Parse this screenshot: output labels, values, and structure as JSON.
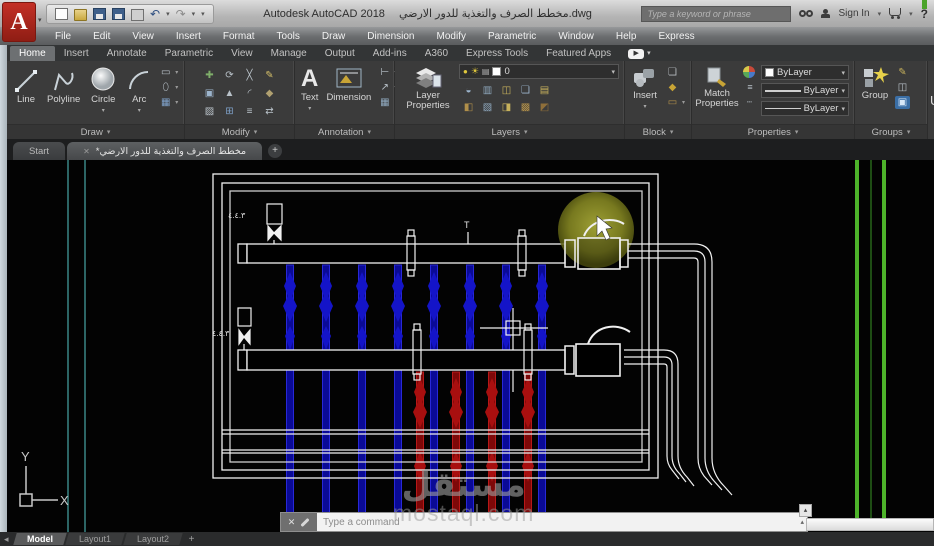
{
  "titlebar": {
    "app_title": "Autodesk AutoCAD 2018",
    "doc_title": "مخطط الصرف والتغذية للدور الارضي.dwg",
    "search_placeholder": "Type a keyword or phrase",
    "sign_in_label": "Sign In",
    "help_glyph": "?"
  },
  "menubar": {
    "items": [
      "File",
      "Edit",
      "View",
      "Insert",
      "Format",
      "Tools",
      "Draw",
      "Dimension",
      "Modify",
      "Parametric",
      "Window",
      "Help",
      "Express"
    ]
  },
  "ribbon": {
    "tabs": [
      {
        "label": "Home",
        "active": true
      },
      {
        "label": "Insert"
      },
      {
        "label": "Annotate"
      },
      {
        "label": "Parametric"
      },
      {
        "label": "View"
      },
      {
        "label": "Manage"
      },
      {
        "label": "Output"
      },
      {
        "label": "Add-ins"
      },
      {
        "label": "A360"
      },
      {
        "label": "Express Tools"
      },
      {
        "label": "Featured Apps"
      }
    ],
    "draw": {
      "label": "Draw",
      "line": "Line",
      "polyline": "Polyline",
      "circle": "Circle",
      "arc": "Arc"
    },
    "modify": {
      "label": "Modify"
    },
    "annotation": {
      "label": "Annotation",
      "text": "Text",
      "dimension": "Dimension"
    },
    "layers": {
      "label": "Layers",
      "layer_properties": "Layer Properties",
      "current_layer": "0"
    },
    "block": {
      "label": "Block",
      "insert": "Insert"
    },
    "properties": {
      "label": "Properties",
      "match_properties": "Match Properties",
      "color_value": "ByLayer",
      "lineweight_value": "ByLayer",
      "linetype_value": "ByLayer"
    },
    "groups": {
      "label": "Groups",
      "group": "Group"
    },
    "utilities_partial": "U"
  },
  "file_tabs": {
    "start": "Start",
    "document": "*مخطط الصرف والتغذية للدور الارضي",
    "new_tab": "+"
  },
  "canvas": {
    "ucs": {
      "x": "X",
      "y": "Y"
    },
    "annotations": {
      "valve_label_top": "٤.٤.٣",
      "valve_label_bottom": "٤.٤.٣",
      "tee_marker": "T"
    },
    "watermark": {
      "arabic": "مستقل",
      "domain": "mostaql.com"
    }
  },
  "command_line": {
    "prompt": "Type a command"
  },
  "layout_tabs": {
    "items": [
      {
        "label": "Model",
        "active": true
      },
      {
        "label": "Layout1"
      },
      {
        "label": "Layout2"
      }
    ],
    "new_tab": "+"
  },
  "icons": {
    "caret": "▾",
    "caret_up": "▴",
    "back": "◂",
    "undo": "↶",
    "redo": "↷",
    "plus": "+",
    "close": "✕",
    "bulb": "●",
    "sun": "☀",
    "printer": "▤",
    "lock": "▪",
    "move": "✚",
    "rotate": "⟳",
    "trim": "╳",
    "pencil": "✎",
    "copy": "▣",
    "mirror": "▲",
    "fillet": "◜",
    "cube": "◆",
    "erase": "▨",
    "array": "⊞",
    "offset": "≡",
    "stretch": "⇄",
    "leader": "↗",
    "table": "▦",
    "textstyle": "A",
    "l1": "◒",
    "l2": "▥",
    "l3": "◫",
    "l4": "❏",
    "l5": "▤",
    "l6": "◧",
    "l7": "▧",
    "l8": "◨",
    "l9": "▩",
    "l10": "◩",
    "b1": "❏",
    "b2": "◆",
    "b3": "▭",
    "g1": "✎",
    "g2": "◫",
    "g3": "▣"
  }
}
